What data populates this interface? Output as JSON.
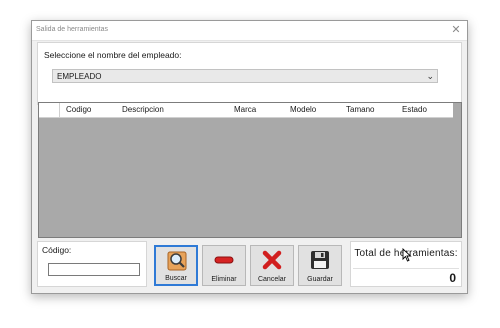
{
  "window": {
    "title": "Salida de herramientas",
    "close_symbol": "✕"
  },
  "employee_group": {
    "label": "Seleccione el nombre del empleado:",
    "combo_value": "EMPLEADO",
    "combo_arrow": "⌄"
  },
  "table": {
    "columns": [
      "Codigo",
      "Descripcion",
      "Marca",
      "Modelo",
      "Tamano",
      "Estado"
    ],
    "rows": []
  },
  "codigo": {
    "label": "Código:",
    "value": ""
  },
  "buttons": {
    "buscar": "Buscar",
    "eliminar": "Eliminar",
    "cancelar": "Cancelar",
    "guardar": "Guardar"
  },
  "total": {
    "label": "Total de herramientas:",
    "value": "0"
  },
  "colors": {
    "grid_background": "#a9a9a9",
    "window_background": "#f0f0f0",
    "active_border": "#2f7ad6",
    "cancel_red": "#d11f1f"
  },
  "icons": {
    "buscar": "magnifier-icon",
    "eliminar": "remove-icon",
    "cancelar": "red-x-icon",
    "guardar": "floppy-disk-icon"
  }
}
